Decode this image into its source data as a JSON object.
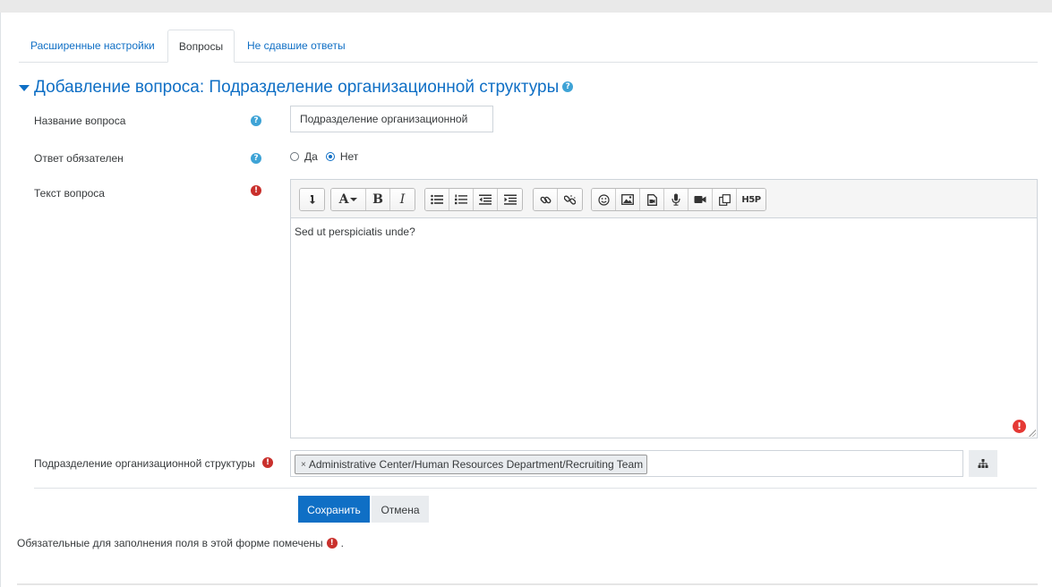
{
  "tabs": [
    {
      "label": "Расширенные настройки"
    },
    {
      "label": "Вопросы"
    },
    {
      "label": "Не сдавшие ответы"
    }
  ],
  "section": {
    "title": "Добавление вопроса: Подразделение организационной структуры"
  },
  "fields": {
    "name": {
      "label": "Название вопроса",
      "value": "Подразделение организационной"
    },
    "required": {
      "label": "Ответ обязателен",
      "options": [
        "Да",
        "Нет"
      ],
      "selected": "Нет"
    },
    "text": {
      "label": "Текст вопроса",
      "content": "Sed ut perspiciatis unde?"
    },
    "org": {
      "label": "Подразделение организационной структуры",
      "tag": "Administrative Center/Human Resources Department/Recruiting Team",
      "tag_remove": "×"
    }
  },
  "toolbar": {
    "icons": [
      "collapse-icon",
      "font-color-icon",
      "bold-icon",
      "italic-icon",
      "unordered-list-icon",
      "ordered-list-icon",
      "outdent-icon",
      "indent-icon",
      "link-icon",
      "unlink-icon",
      "emoticon-icon",
      "image-icon",
      "media-icon",
      "record-audio-icon",
      "record-video-icon",
      "manage-files-icon",
      "h5p-icon"
    ],
    "bold": "B",
    "italic": "I",
    "font": "A",
    "h5p": "H5P"
  },
  "buttons": {
    "save": "Сохранить",
    "cancel": "Отмена"
  },
  "footnote": {
    "text": "Обязательные для заполнения поля в этой форме помечены",
    "end": "."
  },
  "colors": {
    "accent": "#0f6fc5",
    "required": "#c9302c",
    "help": "#3ea3d6"
  }
}
